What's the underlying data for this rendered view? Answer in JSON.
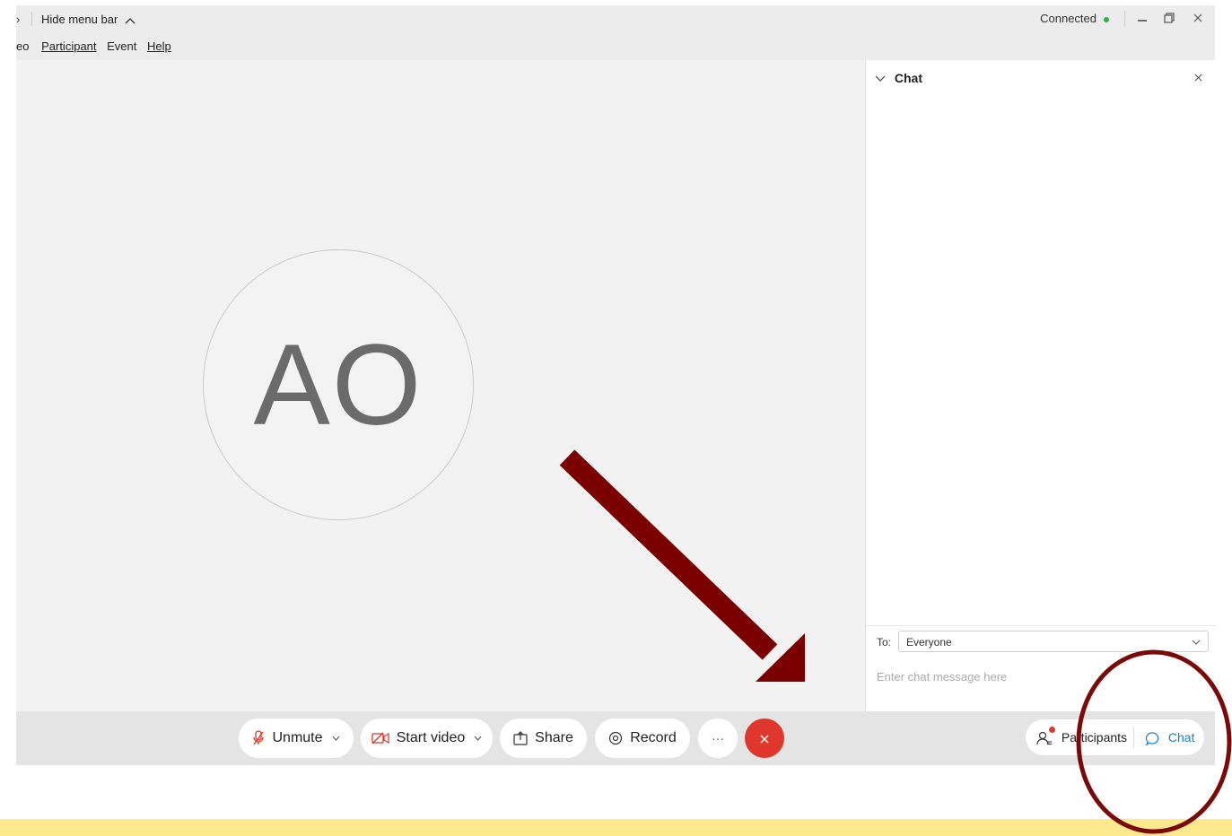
{
  "titlebar": {
    "left_fragment": "›",
    "hide_menu_label": "Hide menu bar",
    "hide_menu_icon": "chevron-up-icon",
    "status_text": "Connected",
    "status_color": "#2fb24c",
    "window_buttons": [
      "minimize-icon",
      "restore-icon",
      "close-icon"
    ]
  },
  "menubar": {
    "items": [
      "eo",
      "Participant",
      "Event",
      "Help"
    ]
  },
  "stage": {
    "avatar_initials": "AO"
  },
  "chat_panel": {
    "title": "Chat",
    "to_label": "To:",
    "to_value": "Everyone",
    "message_placeholder": "Enter chat message here"
  },
  "controls": {
    "unmute_label": "Unmute",
    "start_video_label": "Start video",
    "share_label": "Share",
    "record_label": "Record",
    "more_label": "···",
    "end_icon": "close-icon",
    "end_color": "#e0372c"
  },
  "right_controls": {
    "participants_label": "Participants",
    "chat_label": "Chat",
    "chat_color": "#1a7fc7"
  },
  "annotations": {
    "arrow_color": "#7a0000",
    "circle_color": "#7a0a0a",
    "bottom_bar_color": "#fde98d"
  }
}
